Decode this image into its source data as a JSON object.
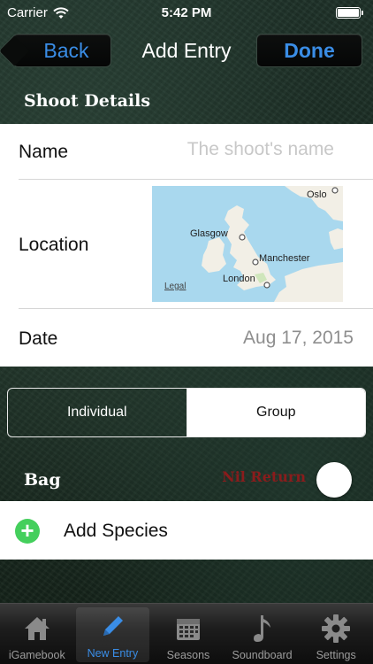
{
  "status_bar": {
    "carrier": "Carrier",
    "time": "5:42 PM"
  },
  "nav": {
    "back_label": "Back",
    "title": "Add Entry",
    "done_label": "Done"
  },
  "shoot_details": {
    "header": "Shoot Details",
    "name_label": "Name",
    "name_placeholder": "The shoot's name",
    "name_value": "",
    "location_label": "Location",
    "map_labels": {
      "oslo": "Oslo",
      "glasgow": "Glasgow",
      "manchester": "Manchester",
      "london": "London",
      "legal": "Legal"
    },
    "date_label": "Date",
    "date_value": "Aug 17, 2015"
  },
  "mode_segment": {
    "options": [
      "Individual",
      "Group"
    ],
    "selected": "Individual"
  },
  "bag": {
    "header": "Bag",
    "nil_return_label": "Nil Return",
    "add_species_label": "Add Species"
  },
  "tab_bar": {
    "items": [
      {
        "label": "iGamebook",
        "icon": "home-icon"
      },
      {
        "label": "New Entry",
        "icon": "pencil-icon"
      },
      {
        "label": "Seasons",
        "icon": "calendar-icon"
      },
      {
        "label": "Soundboard",
        "icon": "music-note-icon"
      },
      {
        "label": "Settings",
        "icon": "gear-icon"
      }
    ],
    "active": "New Entry"
  },
  "colors": {
    "accent_blue": "#3a8de6",
    "nil_return_red": "#8a1c1c",
    "add_green": "#44cf5c"
  }
}
